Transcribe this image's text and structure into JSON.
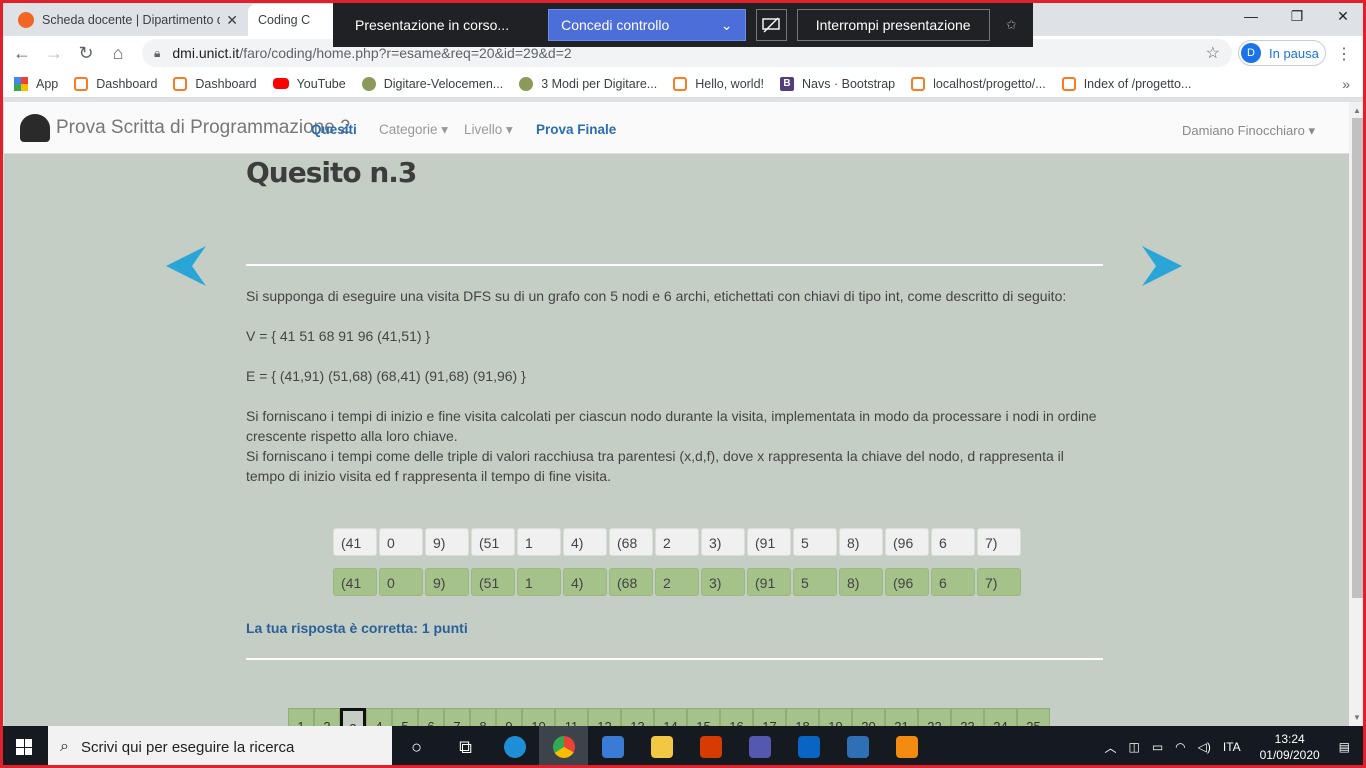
{
  "browser": {
    "tabs": [
      {
        "title": "Scheda docente | Dipartimento di",
        "favicon_color": "#f26522"
      },
      {
        "title": "Coding C"
      }
    ],
    "window_controls": {
      "minimize": "—",
      "restore": "❐",
      "close": "✕"
    },
    "url_host": "dmi.unict.it",
    "url_path": "/faro/coding/home.php?r=esame&req=20&id=29&d=2",
    "profile": {
      "initial": "D",
      "label": "In pausa"
    },
    "bookmarks": [
      {
        "label": "App",
        "icon": "apps"
      },
      {
        "label": "Dashboard",
        "icon": "xampp"
      },
      {
        "label": "Dashboard",
        "icon": "xampp"
      },
      {
        "label": "YouTube",
        "icon": "yt"
      },
      {
        "label": "Digitare-Velocemen...",
        "icon": "wf"
      },
      {
        "label": "3 Modi per Digitare...",
        "icon": "wf"
      },
      {
        "label": "Hello, world!",
        "icon": "xampp"
      },
      {
        "label": "Navs · Bootstrap",
        "icon": "bs"
      },
      {
        "label": "localhost/progetto/...",
        "icon": "xampp"
      },
      {
        "label": "Index of /progetto...",
        "icon": "xampp"
      }
    ]
  },
  "share_bar": {
    "status": "Presentazione in corso...",
    "grant": "Concedi controllo",
    "stop": "Interrompi presentazione"
  },
  "app": {
    "brand": "Prova Scritta di Programmazione 2",
    "nav": [
      {
        "label": "Quesiti",
        "active": true
      },
      {
        "label": "Categorie ▾",
        "active": false
      },
      {
        "label": "Livello ▾",
        "active": false
      },
      {
        "label": "Prova Finale",
        "active": true
      }
    ],
    "user": "Damiano Finocchiaro ▾"
  },
  "question": {
    "title": "Quesito n.3",
    "intro": "Si supponga di eseguire una visita DFS su di un grafo con 5 nodi e 6 archi, etichettati con chiavi di tipo int, come descritto di seguito:",
    "vertices": "V = { 41 51 68 91 96 (41,51) }",
    "edges": "E = { (41,91) (51,68) (68,41) (91,68) (91,96) }",
    "instr1": "Si forniscano i tempi di inizio e fine visita calcolati per ciascun nodo durante la visita, implementata in modo da processare i nodi in ordine crescente rispetto alla loro chiave.",
    "instr2": "Si forniscano i tempi come delle triple di valori racchiusa tra parentesi (x,d,f), dove x rappresenta la chiave del nodo, d rappresenta il tempo di inizio visita ed f rappresenta il tempo di fine visita.",
    "answer": [
      "(41",
      "0",
      "9)",
      "(51",
      "1",
      "4)",
      "(68",
      "2",
      "3)",
      "(91",
      "5",
      "8)",
      "(96",
      "6",
      "7)"
    ],
    "solution": [
      "(41",
      "0",
      "9)",
      "(51",
      "1",
      "4)",
      "(68",
      "2",
      "3)",
      "(91",
      "5",
      "8)",
      "(96",
      "6",
      "7)"
    ],
    "feedback": "La tua risposta è corretta: 1 punti"
  },
  "pager": [
    "1",
    "2",
    "3",
    "4",
    "5",
    "6",
    "7",
    "8",
    "9",
    "10",
    "11",
    "12",
    "13",
    "14",
    "15",
    "16",
    "17",
    "18",
    "19",
    "20",
    "21",
    "22",
    "23",
    "24",
    "25"
  ],
  "pager_current": "3",
  "taskbar": {
    "search": "Scrivi qui per eseguire la ricerca",
    "lang": "ITA",
    "time": "13:24",
    "date": "01/09/2020"
  },
  "colors": {
    "page_bg": "#c5cec5",
    "correct_cell": "#a4c28a",
    "arrow": "#2aa5d8",
    "link": "#2a6db0",
    "frame": "#e0202a"
  }
}
